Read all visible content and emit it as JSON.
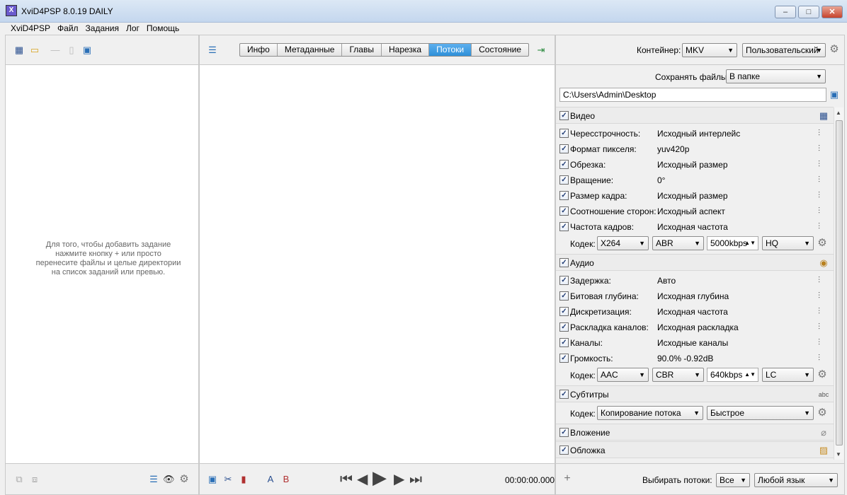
{
  "window": {
    "title": "XviD4PSP 8.0.19 DAILY",
    "min": "–",
    "max": "□",
    "close": "✕"
  },
  "menu": [
    "XviD4PSP",
    "Файл",
    "Задания",
    "Лог",
    "Помощь"
  ],
  "left_pane": {
    "empty_message": "Для того, чтобы добавить задание нажмите кнопку + или просто перенесите файлы и целые директории на список заданий или превью."
  },
  "center_pane": {
    "tabs": [
      {
        "label": "Инфо",
        "active": false
      },
      {
        "label": "Метаданные",
        "active": false
      },
      {
        "label": "Главы",
        "active": false
      },
      {
        "label": "Нарезка",
        "active": false
      },
      {
        "label": "Потоки",
        "active": true
      },
      {
        "label": "Состояние",
        "active": false
      }
    ],
    "time": "00:00:00.000"
  },
  "right_pane": {
    "container_label": "Контейнер:",
    "container_value": "MKV",
    "preset_value": "Пользовательский",
    "save_label": "Сохранять файлы:",
    "save_value": "В папке",
    "path": "C:\\Users\\Admin\\Desktop",
    "video": {
      "title": "Видео",
      "rows": [
        {
          "name": "Чересстрочность:",
          "value": "Исходный интерлейс"
        },
        {
          "name": "Формат пикселя:",
          "value": "yuv420p"
        },
        {
          "name": "Обрезка:",
          "value": "Исходный размер"
        },
        {
          "name": "Вращение:",
          "value": "0°"
        },
        {
          "name": "Размер кадра:",
          "value": "Исходный размер"
        },
        {
          "name": "Соотношение сторон:",
          "value": "Исходный аспект"
        },
        {
          "name": "Частота кадров:",
          "value": "Исходная частота"
        }
      ],
      "codec_label": "Кодек:",
      "codec": "X264",
      "mode": "ABR",
      "bitrate": "5000kbps",
      "preset": "HQ"
    },
    "audio": {
      "title": "Аудио",
      "rows": [
        {
          "name": "Задержка:",
          "value": "Авто"
        },
        {
          "name": "Битовая глубина:",
          "value": "Исходная глубина"
        },
        {
          "name": "Дискретизация:",
          "value": "Исходная частота"
        },
        {
          "name": "Раскладка каналов:",
          "value": "Исходная раскладка"
        },
        {
          "name": "Каналы:",
          "value": "Исходные каналы"
        },
        {
          "name": "Громкость:",
          "value": "90.0% -0.92dB"
        }
      ],
      "codec_label": "Кодек:",
      "codec": "AAC",
      "mode": "CBR",
      "bitrate": "640kbps",
      "profile": "LC"
    },
    "subtitles": {
      "title": "Субтитры",
      "codec_label": "Кодек:",
      "codec": "Копирование потока",
      "speed": "Быстрое"
    },
    "attachment": {
      "title": "Вложение"
    },
    "cover": {
      "title": "Обложка"
    },
    "select_streams_label": "Выбирать потоки:",
    "select_streams_value": "Все",
    "language_value": "Любой язык"
  }
}
